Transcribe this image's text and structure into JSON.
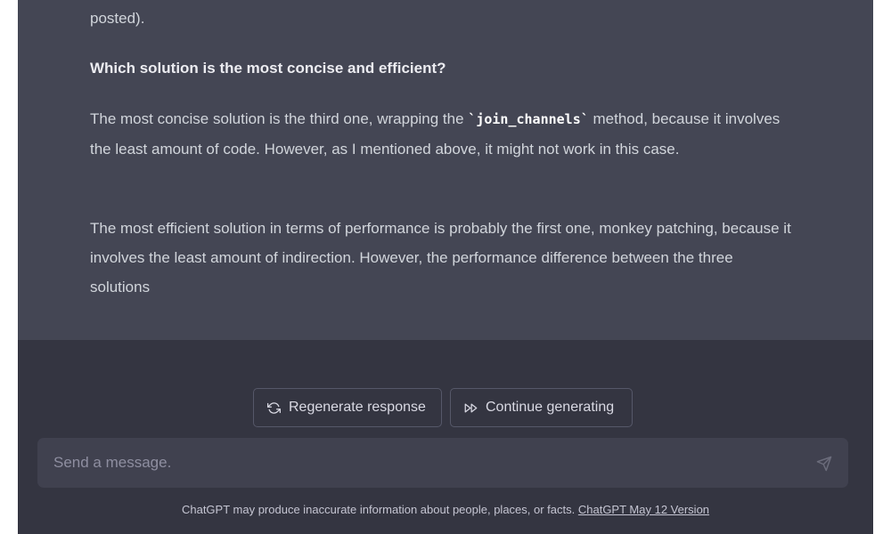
{
  "conversation": {
    "message": {
      "top_fragment": "posted).",
      "heading": "Which solution is the most concise and efficient?",
      "concise_before": "The most concise solution is the third one, wrapping the ",
      "concise_code": "`join_channels`",
      "concise_after": " method, because it involves the least amount of code. However, as I mentioned above, it might not work in this case.",
      "efficient_text": "The most efficient solution in terms of performance is probably the first one, monkey patching, because it involves the least amount of indirection. However, the performance difference between the three solutions"
    }
  },
  "actions": {
    "regenerate_label": "Regenerate response",
    "regenerate_icon": "refresh-icon",
    "continue_label": "Continue generating",
    "continue_icon": "fast-forward-icon"
  },
  "composer": {
    "placeholder": "Send a message.",
    "value": "",
    "send_icon": "send-icon"
  },
  "footer": {
    "disclaimer": "ChatGPT may produce inaccurate information about people, places, or facts. ",
    "version_link": "ChatGPT May 12 Version"
  },
  "colors": {
    "message_bg": "#444654",
    "page_bg": "#343541",
    "input_bg": "#40414f",
    "text": "#d1d5db"
  }
}
